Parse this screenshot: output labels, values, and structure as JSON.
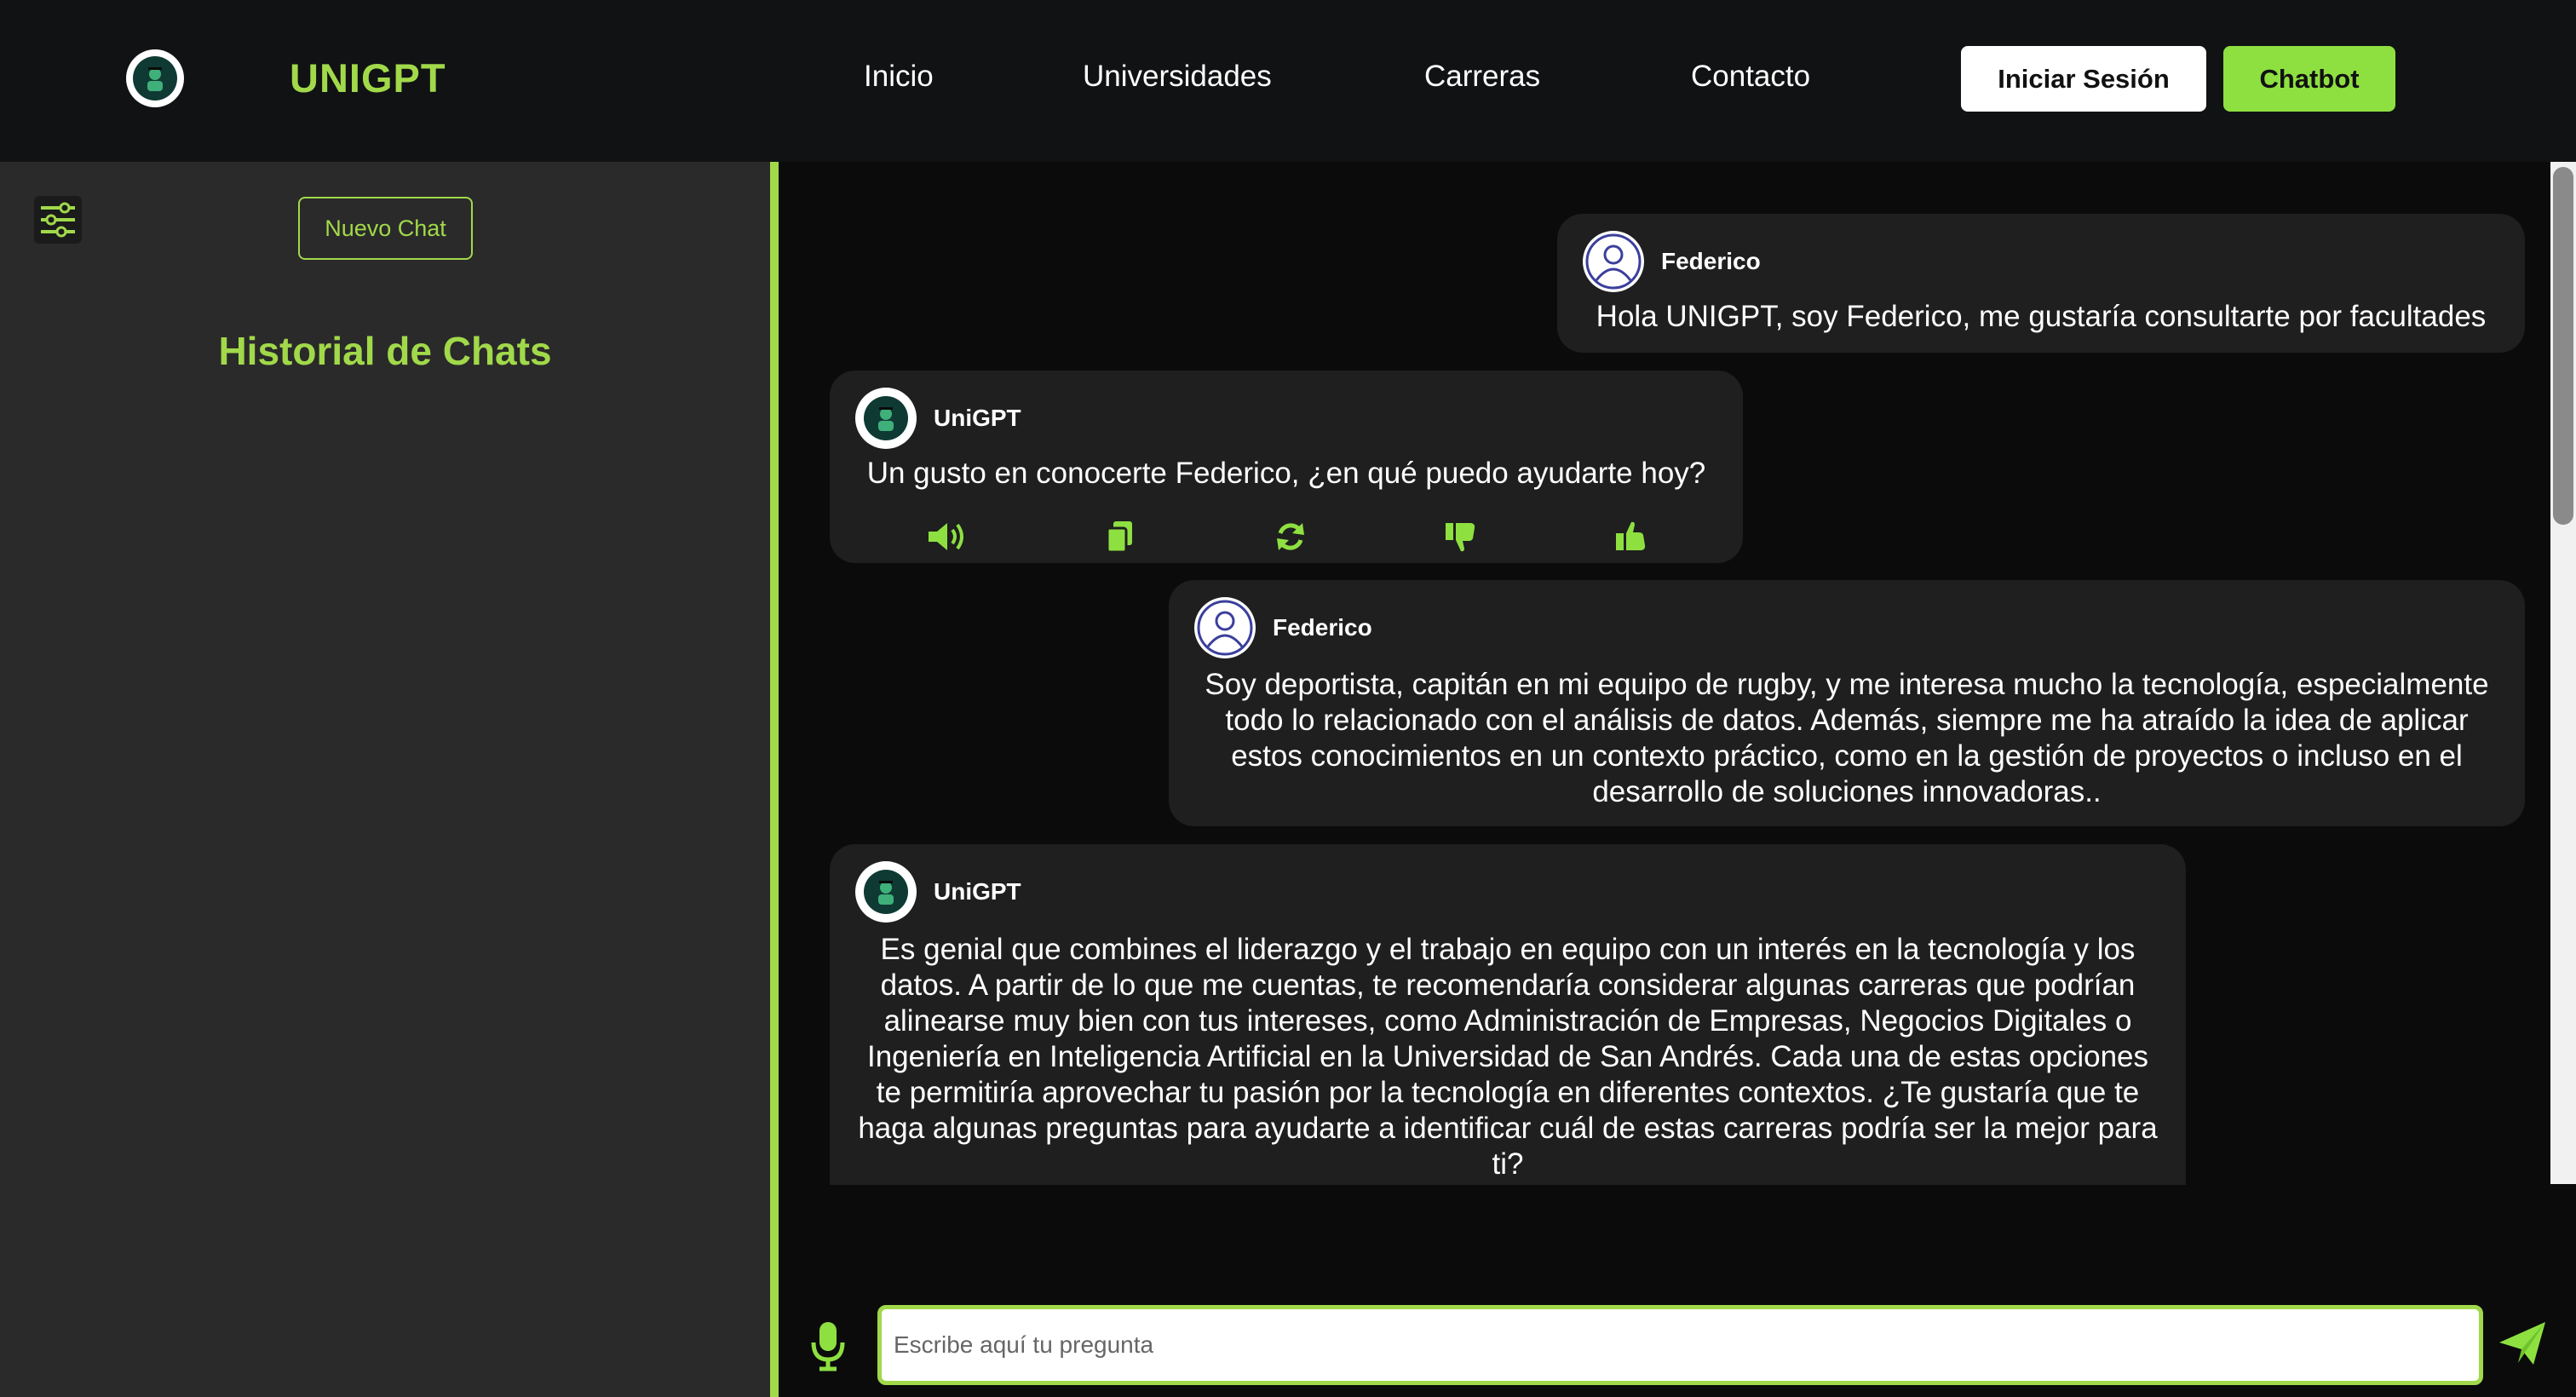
{
  "header": {
    "brand": "UNIGPT",
    "nav": [
      "Inicio",
      "Universidades",
      "Carreras",
      "Contacto"
    ],
    "login_label": "Iniciar Sesión",
    "chatbot_label": "Chatbot"
  },
  "sidebar": {
    "new_chat_label": "Nuevo Chat",
    "history_title": "Historial de Chats"
  },
  "messages": [
    {
      "author": "Federico",
      "role": "user",
      "text": "Hola UNIGPT, soy Federico, me gustaría consultarte por facultades"
    },
    {
      "author": "UniGPT",
      "role": "bot",
      "text": "Un gusto en conocerte Federico, ¿en qué puedo ayudarte hoy?"
    },
    {
      "author": "Federico",
      "role": "user",
      "text": "Soy deportista, capitán en mi equipo de rugby, y me interesa mucho la tecnología, especialmente todo lo relacionado con el análisis de datos. Además, siempre me ha atraído la idea de aplicar estos conocimientos en un contexto práctico, como en la gestión de proyectos o incluso en el desarrollo de soluciones innovadoras.."
    },
    {
      "author": "UniGPT",
      "role": "bot",
      "text": "Es genial que combines el liderazgo y el trabajo en equipo con un interés en la tecnología y los datos. A partir de lo que me cuentas, te recomendaría considerar algunas carreras que podrían alinearse muy bien con tus intereses, como Administración de Empresas, Negocios Digitales o Ingeniería en Inteligencia Artificial en la Universidad de San Andrés. Cada una de estas opciones te permitiría aprovechar tu pasión por la tecnología en diferentes contextos. ¿Te gustaría que te haga algunas preguntas para ayudarte a identificar cuál de estas carreras podría ser la mejor para ti?"
    }
  ],
  "message_actions": [
    "speaker-icon",
    "copy-icon",
    "refresh-icon",
    "thumbs-down-icon",
    "thumbs-up-icon"
  ],
  "input": {
    "placeholder": "Escribe aquí tu pregunta"
  },
  "colors": {
    "accent": "#a1d94a",
    "chatbot_button": "#8ee041",
    "bubble": "#1f1f1f",
    "sidebar": "#2a2a2a",
    "topbar": "#111213"
  }
}
